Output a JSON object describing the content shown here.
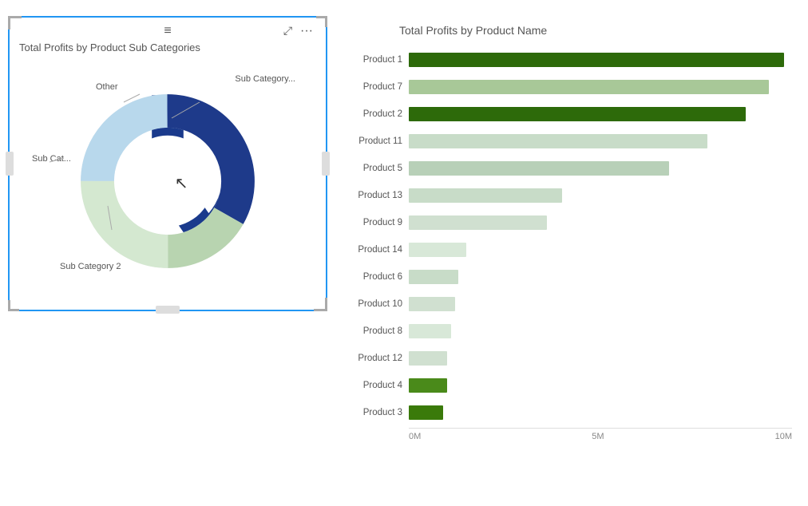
{
  "donut": {
    "title": "Total Profits by Product Sub Categories",
    "labels": {
      "other": "Other",
      "sub_category_main": "Sub Category...",
      "sub_cat_left": "Sub Cat...",
      "sub_category2": "Sub Category 2"
    },
    "segments": [
      {
        "name": "Sub Category Main",
        "color": "#1a3a8c",
        "percent": 30,
        "startAngle": -30,
        "endAngle": 90
      },
      {
        "name": "Other",
        "color": "#a8c8a0",
        "percent": 20,
        "startAngle": 90,
        "endAngle": 170
      },
      {
        "name": "Sub Cat Left",
        "color": "#c8dfc8",
        "percent": 25,
        "startAngle": 170,
        "endAngle": 260
      },
      {
        "name": "Sub Category 2",
        "color": "#b8d8e8",
        "percent": 25,
        "startAngle": 260,
        "endAngle": 330
      }
    ]
  },
  "bar_chart": {
    "title": "Total Profits by Product Name",
    "axis_labels": [
      "0M",
      "5M",
      "10M"
    ],
    "max_value": 10,
    "bars": [
      {
        "label": "Product 1",
        "value": 9.8,
        "color": "#2d6a0a"
      },
      {
        "label": "Product 7",
        "value": 9.4,
        "color": "#a8c898"
      },
      {
        "label": "Product 2",
        "value": 8.8,
        "color": "#2d6a0a"
      },
      {
        "label": "Product 11",
        "value": 7.8,
        "color": "#c8dcc8"
      },
      {
        "label": "Product 5",
        "value": 6.8,
        "color": "#b8d0b8"
      },
      {
        "label": "Product 13",
        "value": 4.0,
        "color": "#c8dcc8"
      },
      {
        "label": "Product 9",
        "value": 3.6,
        "color": "#d0e0d0"
      },
      {
        "label": "Product 14",
        "value": 1.5,
        "color": "#d8e8d8"
      },
      {
        "label": "Product 6",
        "value": 1.3,
        "color": "#c8dcc8"
      },
      {
        "label": "Product 10",
        "value": 1.2,
        "color": "#d0e0d0"
      },
      {
        "label": "Product 8",
        "value": 1.1,
        "color": "#d8e8d8"
      },
      {
        "label": "Product 12",
        "value": 1.0,
        "color": "#d0e0d0"
      },
      {
        "label": "Product 4",
        "value": 1.0,
        "color": "#4a8a1a"
      },
      {
        "label": "Product 3",
        "value": 0.9,
        "color": "#3a7a0a"
      }
    ]
  },
  "icons": {
    "menu": "≡",
    "expand": "⤢",
    "dots": "···"
  }
}
